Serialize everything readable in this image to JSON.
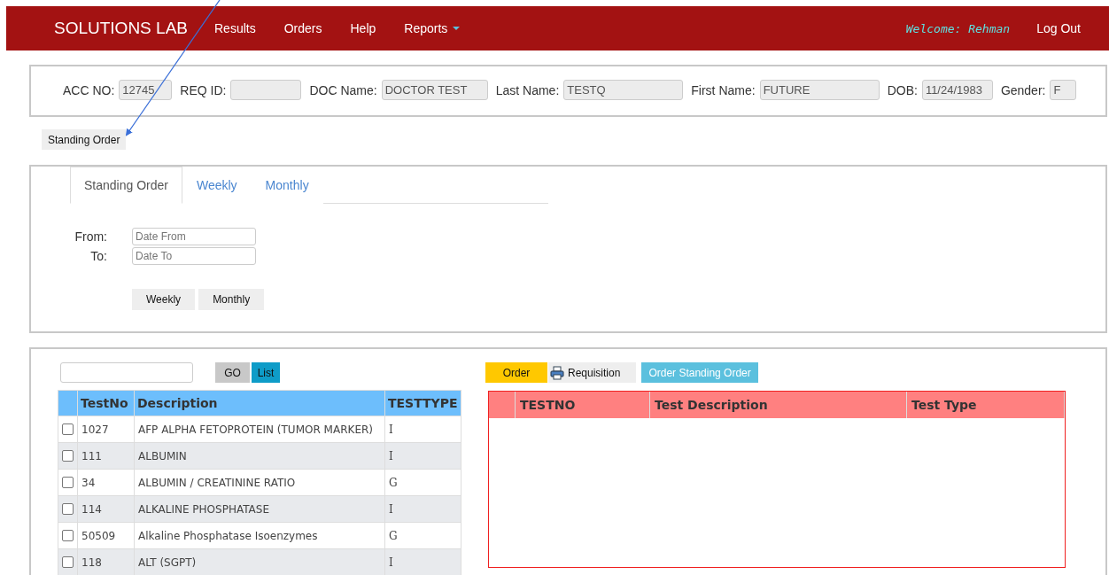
{
  "navbar": {
    "brand": "SOLUTIONS LAB",
    "menu": [
      {
        "label": "Results",
        "dropdown": false
      },
      {
        "label": "Orders",
        "dropdown": false
      },
      {
        "label": "Help",
        "dropdown": false
      },
      {
        "label": "Reports",
        "dropdown": true
      }
    ],
    "welcome": "Welcome: Rehman",
    "logout": "Log Out"
  },
  "patient_fields": [
    {
      "label": "ACC NO:",
      "value": "12745"
    },
    {
      "label": "REQ ID:"
    },
    {
      "label": "DOC Name:",
      "value": "DOCTOR TEST"
    },
    {
      "label": "Last Name:",
      "value": "TESTQ"
    },
    {
      "label": "First Name:",
      "value": "FUTURE"
    },
    {
      "label": "DOB:",
      "value": "11/24/1983"
    },
    {
      "label": "Gender:",
      "value": "F"
    }
  ],
  "standing_order_button": "Standing Order",
  "tabs": [
    {
      "label": "Standing Order",
      "selected": true
    },
    {
      "label": "Weekly",
      "selected": false
    },
    {
      "label": "Monthly",
      "selected": false
    }
  ],
  "date_fields": [
    {
      "label": "From:",
      "placeholder": "Date From"
    },
    {
      "label": "To:",
      "placeholder": "Date To"
    }
  ],
  "period_buttons": [
    "Weekly",
    "Monthly"
  ],
  "search": {
    "go": "GO",
    "list": "List"
  },
  "tests_table": {
    "columns": [
      "TestNo",
      "Description",
      "TESTTYPE"
    ],
    "rows": [
      {
        "checked": false,
        "test_no": "1027",
        "description": "AFP ALPHA FETOPROTEIN (TUMOR MARKER)",
        "type": "I"
      },
      {
        "checked": false,
        "test_no": "111",
        "description": "ALBUMIN",
        "type": "I"
      },
      {
        "checked": false,
        "test_no": "34",
        "description": "ALBUMIN / CREATININE RATIO",
        "type": "G"
      },
      {
        "checked": false,
        "test_no": "114",
        "description": "ALKALINE PHOSPHATASE",
        "type": "I"
      },
      {
        "checked": false,
        "test_no": "50509",
        "description": "Alkaline Phosphatase Isoenzymes",
        "type": "G"
      },
      {
        "checked": false,
        "test_no": "118",
        "description": "ALT (SGPT)",
        "type": "I"
      }
    ]
  },
  "order_buttons": [
    {
      "label": "Order",
      "kind": "order"
    },
    {
      "label": "Requisition",
      "kind": "requisition"
    },
    {
      "label": "Order Standing Order",
      "kind": "standing"
    }
  ],
  "ordered_table": {
    "columns": [
      "TESTNO",
      "Test Description",
      "Test Type"
    ]
  }
}
